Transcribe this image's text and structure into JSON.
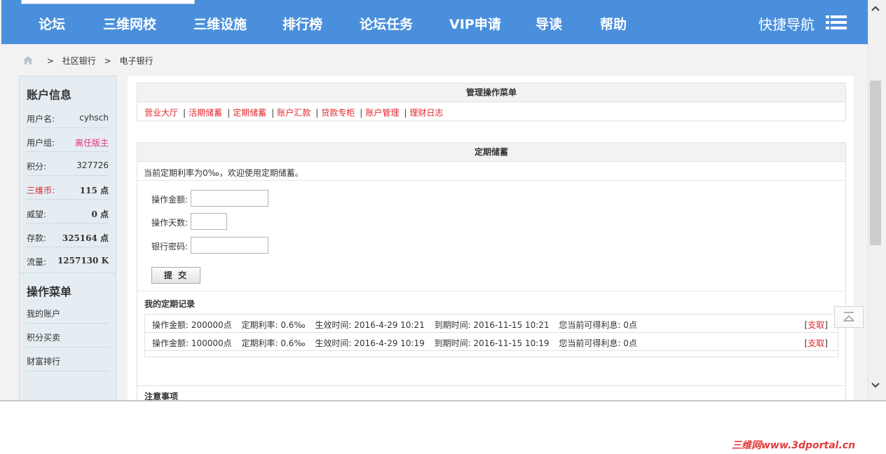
{
  "nav": {
    "items": [
      "论坛",
      "三维网校",
      "三维设施",
      "排行榜",
      "论坛任务",
      "VIP申请",
      "导读",
      "帮助"
    ],
    "quick_nav": "快捷导航"
  },
  "breadcrumb": {
    "items": [
      "社区银行",
      "电子银行"
    ],
    "separator": ">"
  },
  "sidebar": {
    "account_title": "账户信息",
    "fields": [
      {
        "label": "用户名:",
        "value": "cyhsch"
      },
      {
        "label": "用户组:",
        "value": "离任版主"
      },
      {
        "label": "积分:",
        "value": "327726"
      },
      {
        "label": "三维币:",
        "value": "115 点"
      },
      {
        "label": "威望:",
        "value": "0 点"
      },
      {
        "label": "存款:",
        "value": "325164 点"
      },
      {
        "label": "流量:",
        "value": "1257130 K"
      }
    ],
    "menu_title": "操作菜单",
    "menu": [
      "我的账户",
      "积分买卖",
      "财富排行"
    ]
  },
  "menu_box": {
    "title": "管理操作菜单",
    "links": [
      "营业大厅",
      "活期储蓄",
      "定期储蓄",
      "账户汇款",
      "贷款专柜",
      "账户管理",
      "理财日志"
    ],
    "separator": "|"
  },
  "fixed": {
    "title": "定期储蓄",
    "rate_text": "当前定期利率为0‰，欢迎使用定期储蓄。",
    "form": {
      "amount_label": "操作金额:",
      "days_label": "操作天数:",
      "password_label": "银行密码:",
      "submit_label": "提 交"
    },
    "records_title": "我的定期记录",
    "records": [
      {
        "amount": "操作金额: 200000点",
        "rate": "定期利率: 0.6‰",
        "start": "生效时间: 2016-4-29 10:21",
        "due": "到期时间: 2016-11-15 10:21",
        "interest": "您当前可得利息: 0点",
        "action": "支取"
      },
      {
        "amount": "操作金额: 100000点",
        "rate": "定期利率: 0.6‰",
        "start": "生效时间: 2016-4-29 10:19",
        "due": "到期时间: 2016-11-15 10:19",
        "interest": "您当前可得利息: 0点",
        "action": "支取"
      }
    ],
    "notes_title": "注意事项"
  },
  "watermark": "三维网www.3dportal.cn",
  "colors": {
    "nav_bg": "#4a8fdc",
    "link_red": "#e3262d",
    "sidebar_bg": "#e5edf2",
    "group_pink": "#e0337a"
  },
  "icons": {
    "menu": "hamburger-icon",
    "home": "home-icon",
    "back_to_top": "back-to-top-icon",
    "scroll_up": "chevron-up-icon",
    "scroll_down": "chevron-down-icon"
  }
}
